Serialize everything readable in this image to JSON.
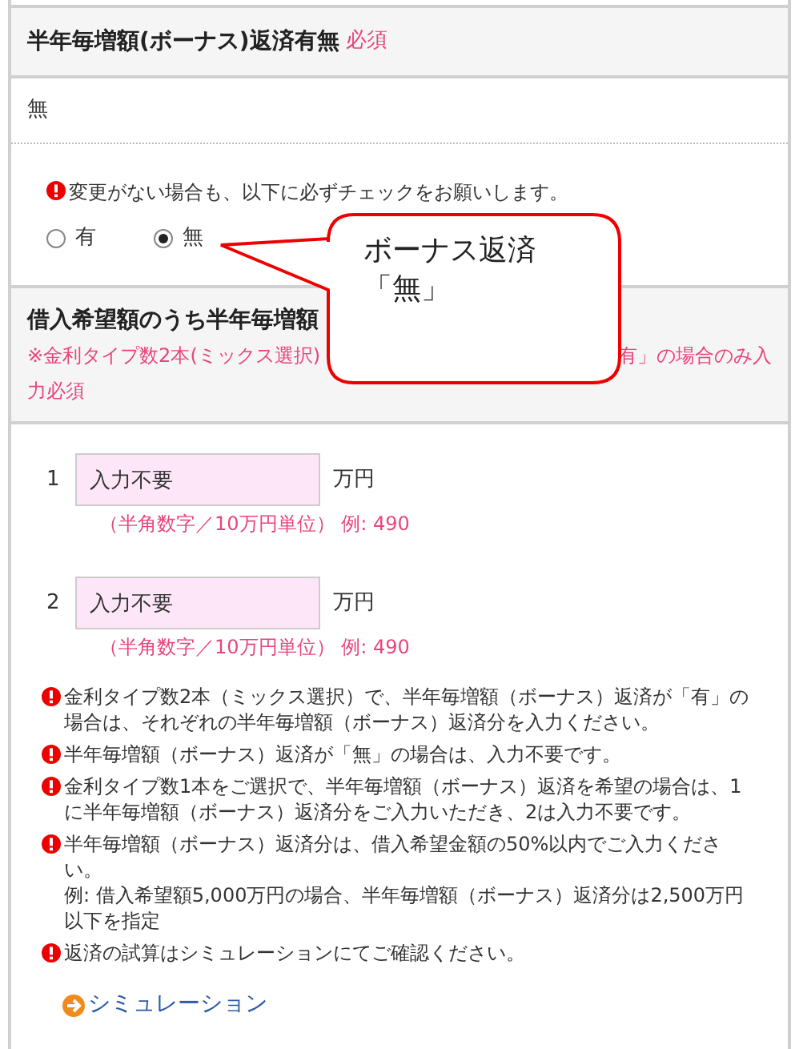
{
  "bonus_section": {
    "title": "半年毎増額(ボーナス)返済有無",
    "required": "必須",
    "current_value": "無",
    "notice": "変更がない場合も、以下に必ずチェックをお願いします。",
    "options": [
      {
        "label": "有",
        "selected": false
      },
      {
        "label": "無",
        "selected": true
      }
    ]
  },
  "callout": {
    "lines": [
      "ボーナス返済",
      "「無」"
    ]
  },
  "amount_section": {
    "title": "借入希望額のうち半年毎増額",
    "note_left": "※金利タイプ数2本(ミックス選択)",
    "note_right": "有」の場合のみ入",
    "note_line2": "力必須",
    "inputs": [
      {
        "number": "1",
        "value": "入力不要",
        "unit": "万円",
        "hint": "（半角数字／10万円単位） 例: 490"
      },
      {
        "number": "2",
        "value": "入力不要",
        "unit": "万円",
        "hint": "（半角数字／10万円単位） 例: 490"
      }
    ],
    "notes": [
      {
        "lines": [
          "金利タイプ数2本（ミックス選択）で、半年毎増額（ボーナス）返済が「有」の場合は、それぞれの半年毎増額（ボーナス）返済分を入力ください。"
        ]
      },
      {
        "lines": [
          "半年毎増額（ボーナス）返済が「無」の場合は、入力不要です。"
        ]
      },
      {
        "lines": [
          "金利タイプ数1本をご選択で、半年毎増額（ボーナス）返済を希望の場合は、1に半年毎増額（ボーナス）返済分をご入力いただき、2は入力不要です。"
        ]
      },
      {
        "lines": [
          "半年毎増額（ボーナス）返済分は、借入希望金額の50%以内でご入力ください。",
          "例: 借入希望額5,000万円の場合、半年毎増額（ボーナス）返済分は2,500万円以下を指定"
        ]
      },
      {
        "lines": [
          "返済の試算はシミュレーションにてご確認ください。"
        ]
      }
    ],
    "link": "シミュレーション"
  }
}
